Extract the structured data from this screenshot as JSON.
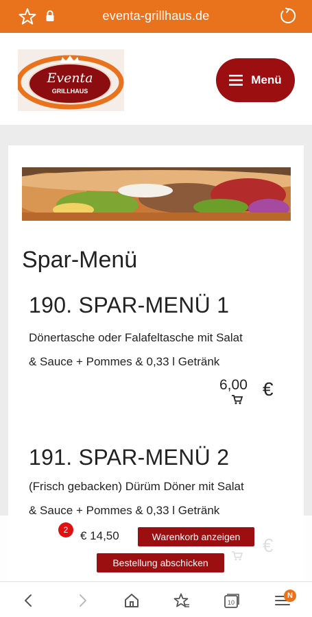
{
  "browser": {
    "url": "eventa-grillhaus.de",
    "tabs_count": "10",
    "menu_badge": "N",
    "icons": [
      "star-icon",
      "lock-icon",
      "reload-icon",
      "back-icon",
      "forward-icon",
      "home-icon",
      "bookmarks-icon",
      "tabs-icon",
      "browser-menu-icon"
    ]
  },
  "header": {
    "logo_text": "Eventa",
    "logo_subtext": "GRILLHAUS",
    "menu_label": "Menü"
  },
  "content": {
    "section_title": "Spar-Menü",
    "items": [
      {
        "title": "190. SPAR-MENÜ 1",
        "desc_line1": "Dönertasche oder Falafeltasche mit Salat",
        "desc_line2": "& Sauce + Pommes & 0,33 l Getränk",
        "price": "6,00",
        "currency": "€"
      },
      {
        "title": "191. SPAR-MENÜ 2",
        "desc_line1": "(Frisch gebacken) Dürüm Döner mit Salat",
        "desc_line2": "& Sauce + Pommes & 0,33 l Getränk",
        "currency": "€"
      }
    ]
  },
  "cart": {
    "count": "2",
    "total": "€ 14,50",
    "show_cart_label": "Warenkorb anzeigen",
    "submit_order_label": "Bestellung abschicken"
  },
  "colors": {
    "browser_bar": "#e9721d",
    "brand_red": "#9c0f10",
    "badge_red": "#e01010"
  }
}
